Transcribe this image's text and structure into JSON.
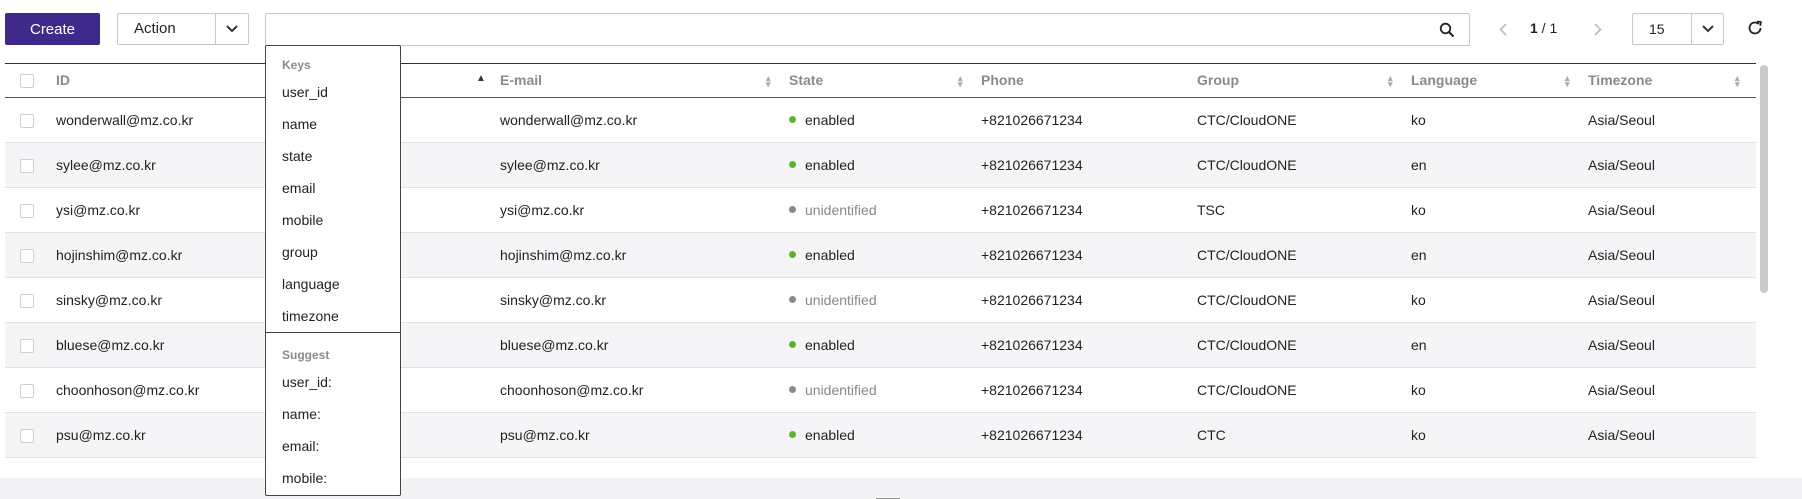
{
  "toolbar": {
    "create_label": "Create",
    "action_label": "Action",
    "search_value": "",
    "pager_current": "1",
    "pager_sep": " / ",
    "pager_total": "1",
    "page_size": "15"
  },
  "colors": {
    "primary": "#3f2a8c",
    "enabled": "#5eb22f",
    "unidentified": "#8a8a8a"
  },
  "table": {
    "columns": [
      {
        "label": ""
      },
      {
        "label": "ID"
      },
      {
        "label": "E-mail"
      },
      {
        "label": "State"
      },
      {
        "label": "Phone"
      },
      {
        "label": "Group"
      },
      {
        "label": "Language"
      },
      {
        "label": "Timezone"
      }
    ],
    "rows": [
      {
        "id": "wonderwall@mz.co.kr",
        "email": "wonderwall@mz.co.kr",
        "state": "enabled",
        "phone": "+821026671234",
        "group": "CTC/CloudONE",
        "language": "ko",
        "timezone": "Asia/Seoul"
      },
      {
        "id": "sylee@mz.co.kr",
        "email": "sylee@mz.co.kr",
        "state": "enabled",
        "phone": "+821026671234",
        "group": "CTC/CloudONE",
        "language": "en",
        "timezone": "Asia/Seoul"
      },
      {
        "id": "ysi@mz.co.kr",
        "email": "ysi@mz.co.kr",
        "state": "unidentified",
        "phone": "+821026671234",
        "group": "TSC",
        "language": "ko",
        "timezone": "Asia/Seoul"
      },
      {
        "id": "hojinshim@mz.co.kr",
        "email": "hojinshim@mz.co.kr",
        "state": "enabled",
        "phone": "+821026671234",
        "group": "CTC/CloudONE",
        "language": "en",
        "timezone": "Asia/Seoul"
      },
      {
        "id": "sinsky@mz.co.kr",
        "email": "sinsky@mz.co.kr",
        "state": "unidentified",
        "phone": "+821026671234",
        "group": "CTC/CloudONE",
        "language": "ko",
        "timezone": "Asia/Seoul"
      },
      {
        "id": "bluese@mz.co.kr",
        "email": "bluese@mz.co.kr",
        "state": "enabled",
        "phone": "+821026671234",
        "group": "CTC/CloudONE",
        "language": "en",
        "timezone": "Asia/Seoul"
      },
      {
        "id": "choonhoson@mz.co.kr",
        "email": "choonhoson@mz.co.kr",
        "state": "unidentified",
        "phone": "+821026671234",
        "group": "CTC/CloudONE",
        "language": "ko",
        "timezone": "Asia/Seoul"
      },
      {
        "id": "psu@mz.co.kr",
        "email": "psu@mz.co.kr",
        "state": "enabled",
        "phone": "+821026671234",
        "group": "CTC",
        "language": "ko",
        "timezone": "Asia/Seoul"
      }
    ]
  },
  "dropdown": {
    "keys_heading": "Keys",
    "keys": [
      "user_id",
      "name",
      "state",
      "email",
      "mobile",
      "group",
      "language",
      "timezone"
    ],
    "suggest_heading": "Suggest",
    "suggest": [
      "user_id:",
      "name:",
      "email:",
      "mobile:"
    ]
  }
}
